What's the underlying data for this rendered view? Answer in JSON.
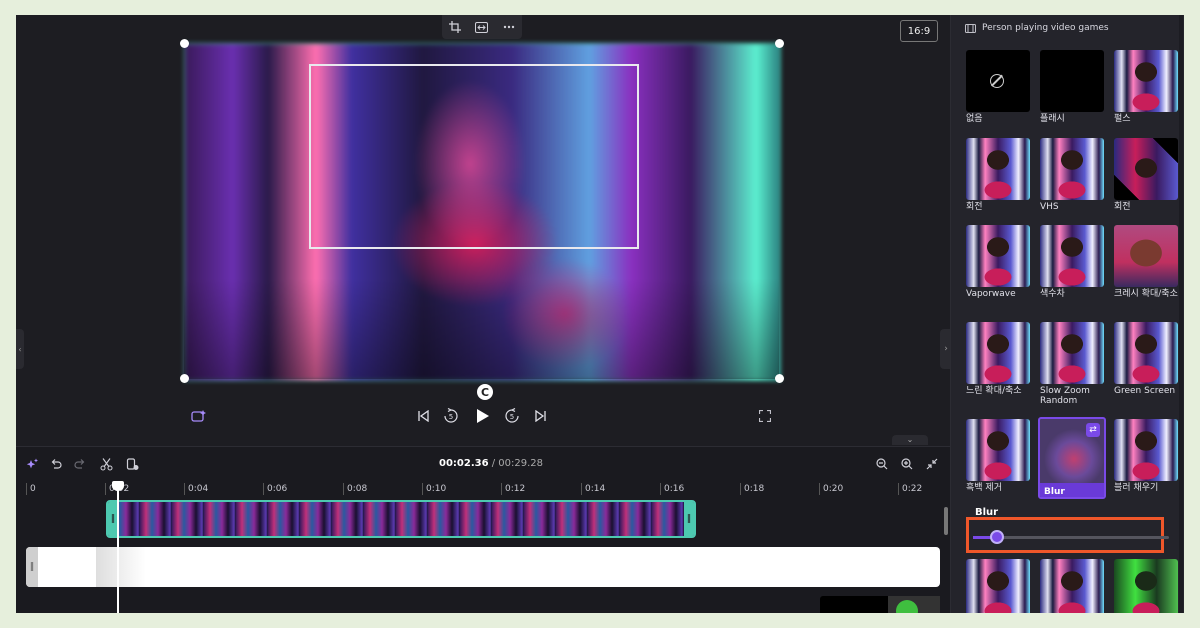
{
  "editor": {
    "aspect_ratio": "16:9",
    "rotate_handle": "C",
    "toolbar_icons": [
      "crop-icon",
      "fit-icon",
      "more-icon"
    ]
  },
  "playback": {
    "controls": [
      "magic-icon",
      "skip-back-icon",
      "rewind-5-icon",
      "play-icon",
      "forward-5-icon",
      "skip-forward-icon",
      "fullscreen-icon"
    ],
    "rewind_label": "5",
    "forward_label": "5"
  },
  "timeline": {
    "current_time": "00:02.36",
    "total_time": " / 00:29.28",
    "ruler": [
      "0",
      "0:02",
      "0:04",
      "0:06",
      "0:08",
      "0:10",
      "0:12",
      "0:14",
      "0:16",
      "0:18",
      "0:20",
      "0:22"
    ],
    "tools": [
      "magic-icon",
      "undo-icon",
      "redo-icon",
      "scissors-icon",
      "delete-icon",
      "zoom-out-icon",
      "zoom-in-icon",
      "fit-timeline-icon"
    ]
  },
  "panel": {
    "header": "Person playing video games",
    "effects": [
      {
        "label": "없음"
      },
      {
        "label": "플래시"
      },
      {
        "label": "펄스"
      },
      {
        "label": "회전"
      },
      {
        "label": "VHS"
      },
      {
        "label": "회전"
      },
      {
        "label": "Vaporwave"
      },
      {
        "label": "색수차"
      },
      {
        "label": "크레시 확대/축소"
      },
      {
        "label": "느린 확대/축소"
      },
      {
        "label": "Slow Zoom Random"
      },
      {
        "label": "Green Screen"
      },
      {
        "label": "흑백 제거"
      },
      {
        "label": "Blur"
      },
      {
        "label": "블러 채우기"
      }
    ],
    "blur_title": "Blur",
    "blur_value": 0.12
  },
  "colors": {
    "accent": "#7a4ae8",
    "clip_border": "#4dc9b0",
    "highlight": "#f0572a"
  }
}
